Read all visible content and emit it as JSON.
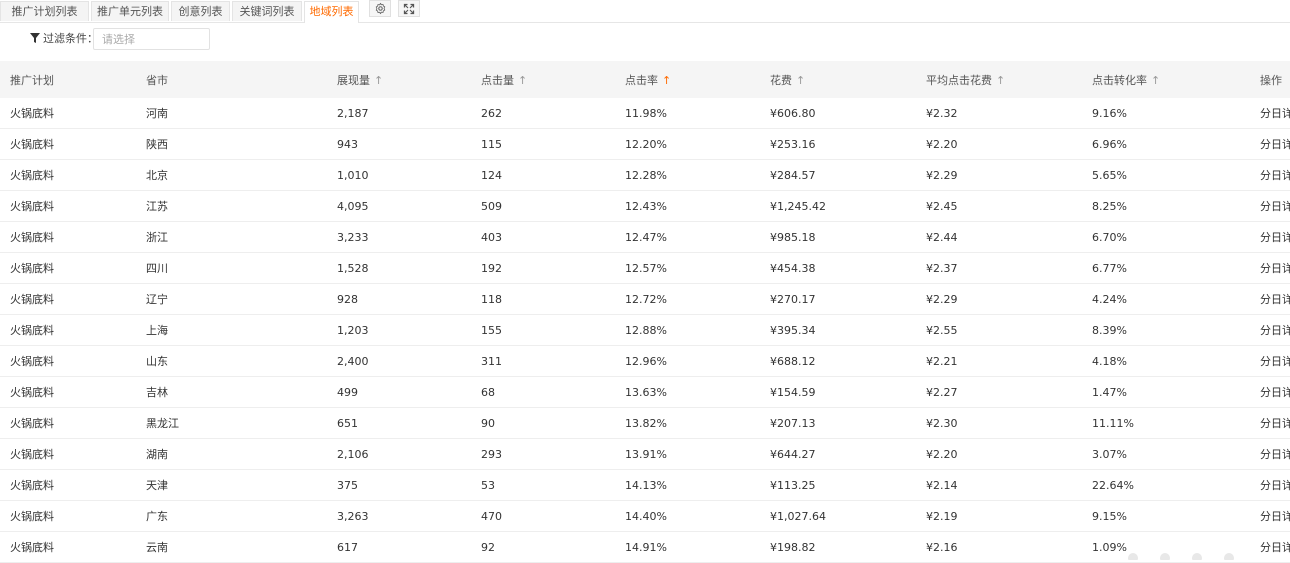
{
  "tabs": [
    {
      "label": "推广计划列表",
      "active": false
    },
    {
      "label": "推广单元列表",
      "active": false
    },
    {
      "label": "创意列表",
      "active": false
    },
    {
      "label": "关键词列表",
      "active": false
    },
    {
      "label": "地域列表",
      "active": true
    }
  ],
  "toolbar": {
    "settings_icon": "gear-icon",
    "fullscreen_icon": "expand-icon"
  },
  "filter": {
    "label": "过滤条件：",
    "placeholder": "请选择",
    "icon": "filter-icon"
  },
  "colors": {
    "accent": "#ff6a00",
    "header_bg": "#f5f5f5",
    "row_border": "#eeeeee"
  },
  "table": {
    "columns": [
      {
        "label": "推广计划",
        "sortable": false
      },
      {
        "label": "省市",
        "sortable": false
      },
      {
        "label": "展现量",
        "sortable": true,
        "sort_active": false
      },
      {
        "label": "点击量",
        "sortable": true,
        "sort_active": false
      },
      {
        "label": "点击率",
        "sortable": true,
        "sort_active": true
      },
      {
        "label": "花费",
        "sortable": true,
        "sort_active": false
      },
      {
        "label": "平均点击花费",
        "sortable": true,
        "sort_active": false
      },
      {
        "label": "点击转化率",
        "sortable": true,
        "sort_active": false
      },
      {
        "label": "操作",
        "sortable": false
      }
    ],
    "sort_glyph": "↑",
    "rows": [
      {
        "plan": "火锅底料",
        "region": "河南",
        "impressions": "2,187",
        "clicks": "262",
        "ctr": "11.98%",
        "cost": "¥606.80",
        "cpc": "¥2.32",
        "cvr": "9.16%",
        "action": "分日详情"
      },
      {
        "plan": "火锅底料",
        "region": "陕西",
        "impressions": "943",
        "clicks": "115",
        "ctr": "12.20%",
        "cost": "¥253.16",
        "cpc": "¥2.20",
        "cvr": "6.96%",
        "action": "分日详情"
      },
      {
        "plan": "火锅底料",
        "region": "北京",
        "impressions": "1,010",
        "clicks": "124",
        "ctr": "12.28%",
        "cost": "¥284.57",
        "cpc": "¥2.29",
        "cvr": "5.65%",
        "action": "分日详情"
      },
      {
        "plan": "火锅底料",
        "region": "江苏",
        "impressions": "4,095",
        "clicks": "509",
        "ctr": "12.43%",
        "cost": "¥1,245.42",
        "cpc": "¥2.45",
        "cvr": "8.25%",
        "action": "分日详情"
      },
      {
        "plan": "火锅底料",
        "region": "浙江",
        "impressions": "3,233",
        "clicks": "403",
        "ctr": "12.47%",
        "cost": "¥985.18",
        "cpc": "¥2.44",
        "cvr": "6.70%",
        "action": "分日详情"
      },
      {
        "plan": "火锅底料",
        "region": "四川",
        "impressions": "1,528",
        "clicks": "192",
        "ctr": "12.57%",
        "cost": "¥454.38",
        "cpc": "¥2.37",
        "cvr": "6.77%",
        "action": "分日详情"
      },
      {
        "plan": "火锅底料",
        "region": "辽宁",
        "impressions": "928",
        "clicks": "118",
        "ctr": "12.72%",
        "cost": "¥270.17",
        "cpc": "¥2.29",
        "cvr": "4.24%",
        "action": "分日详情"
      },
      {
        "plan": "火锅底料",
        "region": "上海",
        "impressions": "1,203",
        "clicks": "155",
        "ctr": "12.88%",
        "cost": "¥395.34",
        "cpc": "¥2.55",
        "cvr": "8.39%",
        "action": "分日详情"
      },
      {
        "plan": "火锅底料",
        "region": "山东",
        "impressions": "2,400",
        "clicks": "311",
        "ctr": "12.96%",
        "cost": "¥688.12",
        "cpc": "¥2.21",
        "cvr": "4.18%",
        "action": "分日详情"
      },
      {
        "plan": "火锅底料",
        "region": "吉林",
        "impressions": "499",
        "clicks": "68",
        "ctr": "13.63%",
        "cost": "¥154.59",
        "cpc": "¥2.27",
        "cvr": "1.47%",
        "action": "分日详情"
      },
      {
        "plan": "火锅底料",
        "region": "黑龙江",
        "impressions": "651",
        "clicks": "90",
        "ctr": "13.82%",
        "cost": "¥207.13",
        "cpc": "¥2.30",
        "cvr": "11.11%",
        "action": "分日详情"
      },
      {
        "plan": "火锅底料",
        "region": "湖南",
        "impressions": "2,106",
        "clicks": "293",
        "ctr": "13.91%",
        "cost": "¥644.27",
        "cpc": "¥2.20",
        "cvr": "3.07%",
        "action": "分日详情"
      },
      {
        "plan": "火锅底料",
        "region": "天津",
        "impressions": "375",
        "clicks": "53",
        "ctr": "14.13%",
        "cost": "¥113.25",
        "cpc": "¥2.14",
        "cvr": "22.64%",
        "action": "分日详情"
      },
      {
        "plan": "火锅底料",
        "region": "广东",
        "impressions": "3,263",
        "clicks": "470",
        "ctr": "14.40%",
        "cost": "¥1,027.64",
        "cpc": "¥2.19",
        "cvr": "9.15%",
        "action": "分日详情"
      },
      {
        "plan": "火锅底料",
        "region": "云南",
        "impressions": "617",
        "clicks": "92",
        "ctr": "14.91%",
        "cost": "¥198.82",
        "cpc": "¥2.16",
        "cvr": "1.09%",
        "action": "分日详情"
      }
    ]
  }
}
